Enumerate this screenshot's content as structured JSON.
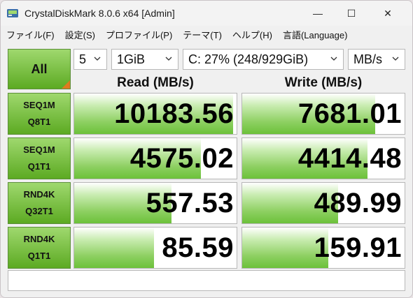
{
  "window": {
    "title": "CrystalDiskMark 8.0.6 x64 [Admin]",
    "controls": {
      "minimize": "—",
      "maximize": "☐",
      "close": "✕"
    }
  },
  "menu": [
    "ファイル(F)",
    "設定(S)",
    "プロファイル(P)",
    "テーマ(T)",
    "ヘルプ(H)",
    "言語(Language)"
  ],
  "controls": {
    "all_label": "All",
    "count": "5",
    "size": "1GiB",
    "drive": "C: 27% (248/929GiB)",
    "unit": "MB/s"
  },
  "headers": {
    "read": "Read (MB/s)",
    "write": "Write (MB/s)"
  },
  "tests": [
    {
      "line1": "SEQ1M",
      "line2": "Q8T1",
      "read": "10183.56",
      "write": "7681.01",
      "read_fill": 0.98,
      "write_fill": 0.82
    },
    {
      "line1": "SEQ1M",
      "line2": "Q1T1",
      "read": "4575.02",
      "write": "4414.48",
      "read_fill": 0.78,
      "write_fill": 0.77
    },
    {
      "line1": "RND4K",
      "line2": "Q32T1",
      "read": "557.53",
      "write": "489.99",
      "read_fill": 0.6,
      "write_fill": 0.59
    },
    {
      "line1": "RND4K",
      "line2": "Q1T1",
      "read": "85.59",
      "write": "159.91",
      "read_fill": 0.49,
      "write_fill": 0.53
    }
  ],
  "comment": "",
  "colors": {
    "bar_green": "#6cc13a",
    "button_green": "#5caa22",
    "corner_orange": "#e07a1f"
  }
}
